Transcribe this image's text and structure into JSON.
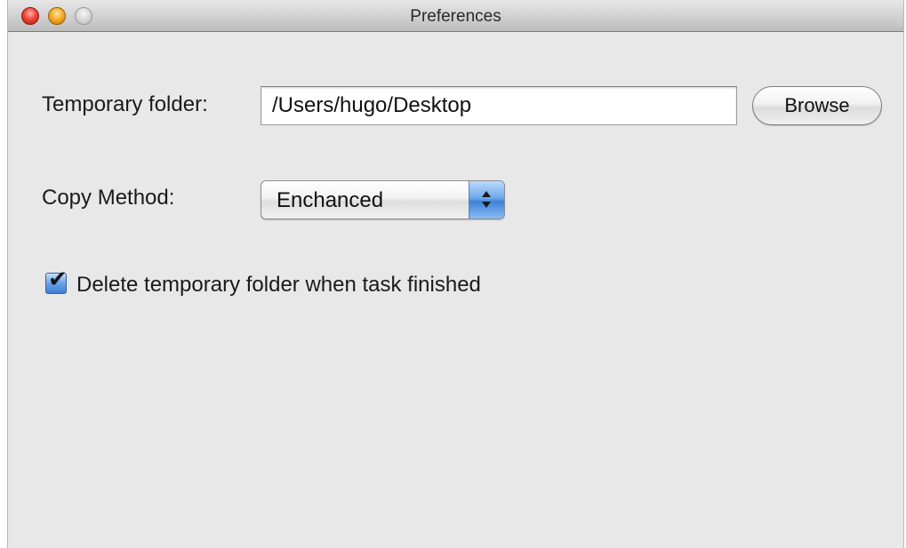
{
  "window": {
    "title": "Preferences"
  },
  "form": {
    "temp_folder_label": "Temporary folder:",
    "temp_folder_value": "/Users/hugo/Desktop",
    "browse_label": "Browse",
    "copy_method_label": "Copy Method:",
    "copy_method_value": "Enchanced",
    "delete_checkbox_checked": true,
    "delete_checkbox_label": "Delete temporary folder when task finished"
  },
  "icons": {
    "close": "close-icon",
    "minimize": "minimize-icon",
    "zoom": "zoom-icon",
    "checkmark": "checkmark-icon",
    "popup_arrows": "chevron-up-down-icon"
  },
  "colors": {
    "window_bg": "#e8e8e8",
    "close": "#f0463a",
    "minimize": "#f7ac2a",
    "zoom": "#d4d4d4",
    "accent_blue": "#3f82d8"
  }
}
